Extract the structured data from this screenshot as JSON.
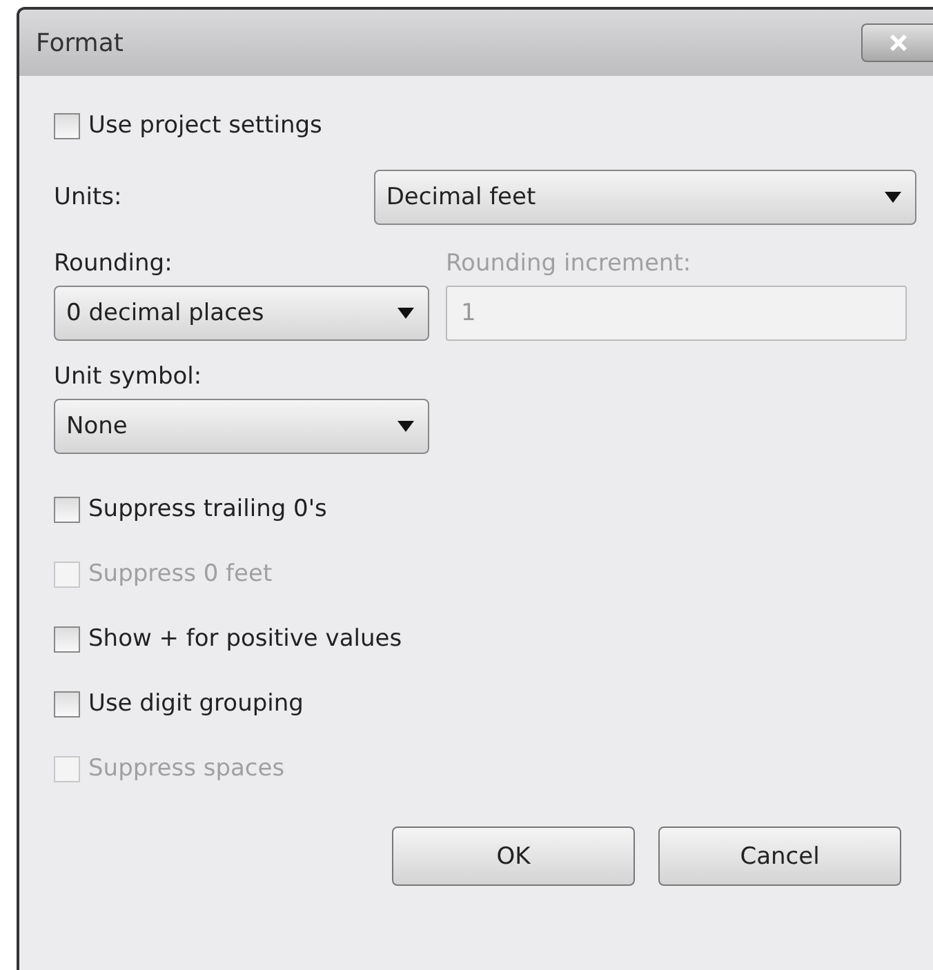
{
  "window": {
    "title": "Format"
  },
  "use_project_settings": {
    "label": "Use project settings",
    "checked": false,
    "disabled": false
  },
  "units": {
    "label": "Units:",
    "value": "Decimal feet"
  },
  "rounding": {
    "label": "Rounding:",
    "value": "0 decimal places"
  },
  "rounding_increment": {
    "label": "Rounding increment:",
    "value": "1",
    "disabled": true
  },
  "unit_symbol": {
    "label": "Unit symbol:",
    "value": "None"
  },
  "options": [
    {
      "label": "Suppress trailing 0's",
      "checked": false,
      "disabled": false
    },
    {
      "label": "Suppress 0 feet",
      "checked": false,
      "disabled": true
    },
    {
      "label": "Show + for positive values",
      "checked": false,
      "disabled": false
    },
    {
      "label": "Use digit grouping",
      "checked": false,
      "disabled": false
    },
    {
      "label": "Suppress spaces",
      "checked": false,
      "disabled": true
    }
  ],
  "buttons": [
    "OK",
    "Cancel"
  ]
}
